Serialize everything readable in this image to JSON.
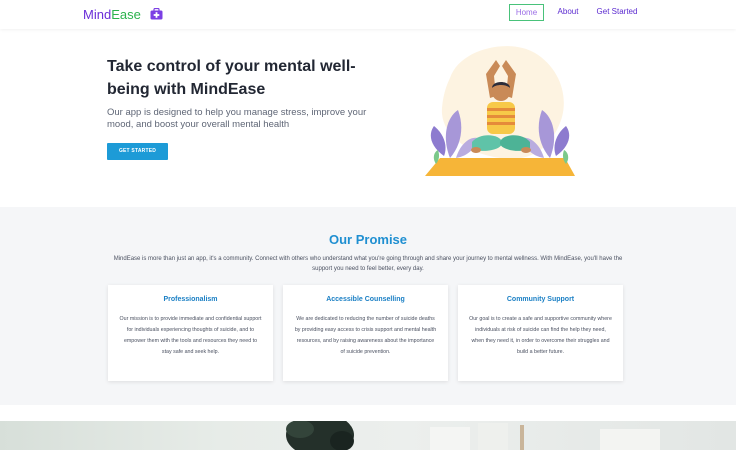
{
  "brand": {
    "part1": "Mind",
    "part2": "Ease",
    "icon": "medical-kit-icon"
  },
  "nav": {
    "home": "Home",
    "about": "About",
    "get_started": "Get Started"
  },
  "hero": {
    "title": "Take control of your mental well-being with MindEase",
    "subtitle": "Our app is designed to help you manage stress, improve your mood, and boost your overall mental health",
    "button": "GET STARTED",
    "illustration": "meditating-person-illustration"
  },
  "promise": {
    "title": "Our Promise",
    "intro": "MindEase is more than just an app, it's a community. Connect with others who understand what you're going through and share your journey to mental wellness. With MindEase, you'll have the support you need to feel better, every day.",
    "cards": [
      {
        "title": "Professionalism",
        "text": "Our mission is to provide immediate and confidential support for individuals experiencing thoughts of suicide, and to empower them with the tools and resources they need to stay safe and seek help."
      },
      {
        "title": "Accessible Counselling",
        "text": "We are dedicated to reducing the number of suicide deaths by providing easy access to crisis support and mental health resources, and by raising awareness about the importance of suicide prevention."
      },
      {
        "title": "Community Support",
        "text": "Our goal is to create a safe and supportive community where individuals at risk of suicide can find the help they need, when they need it, in order to overcome their struggles and build a better future."
      }
    ]
  },
  "colors": {
    "brand_purple": "#6b2fd8",
    "brand_green": "#2bb24c",
    "accent_blue": "#1d9bd7"
  }
}
